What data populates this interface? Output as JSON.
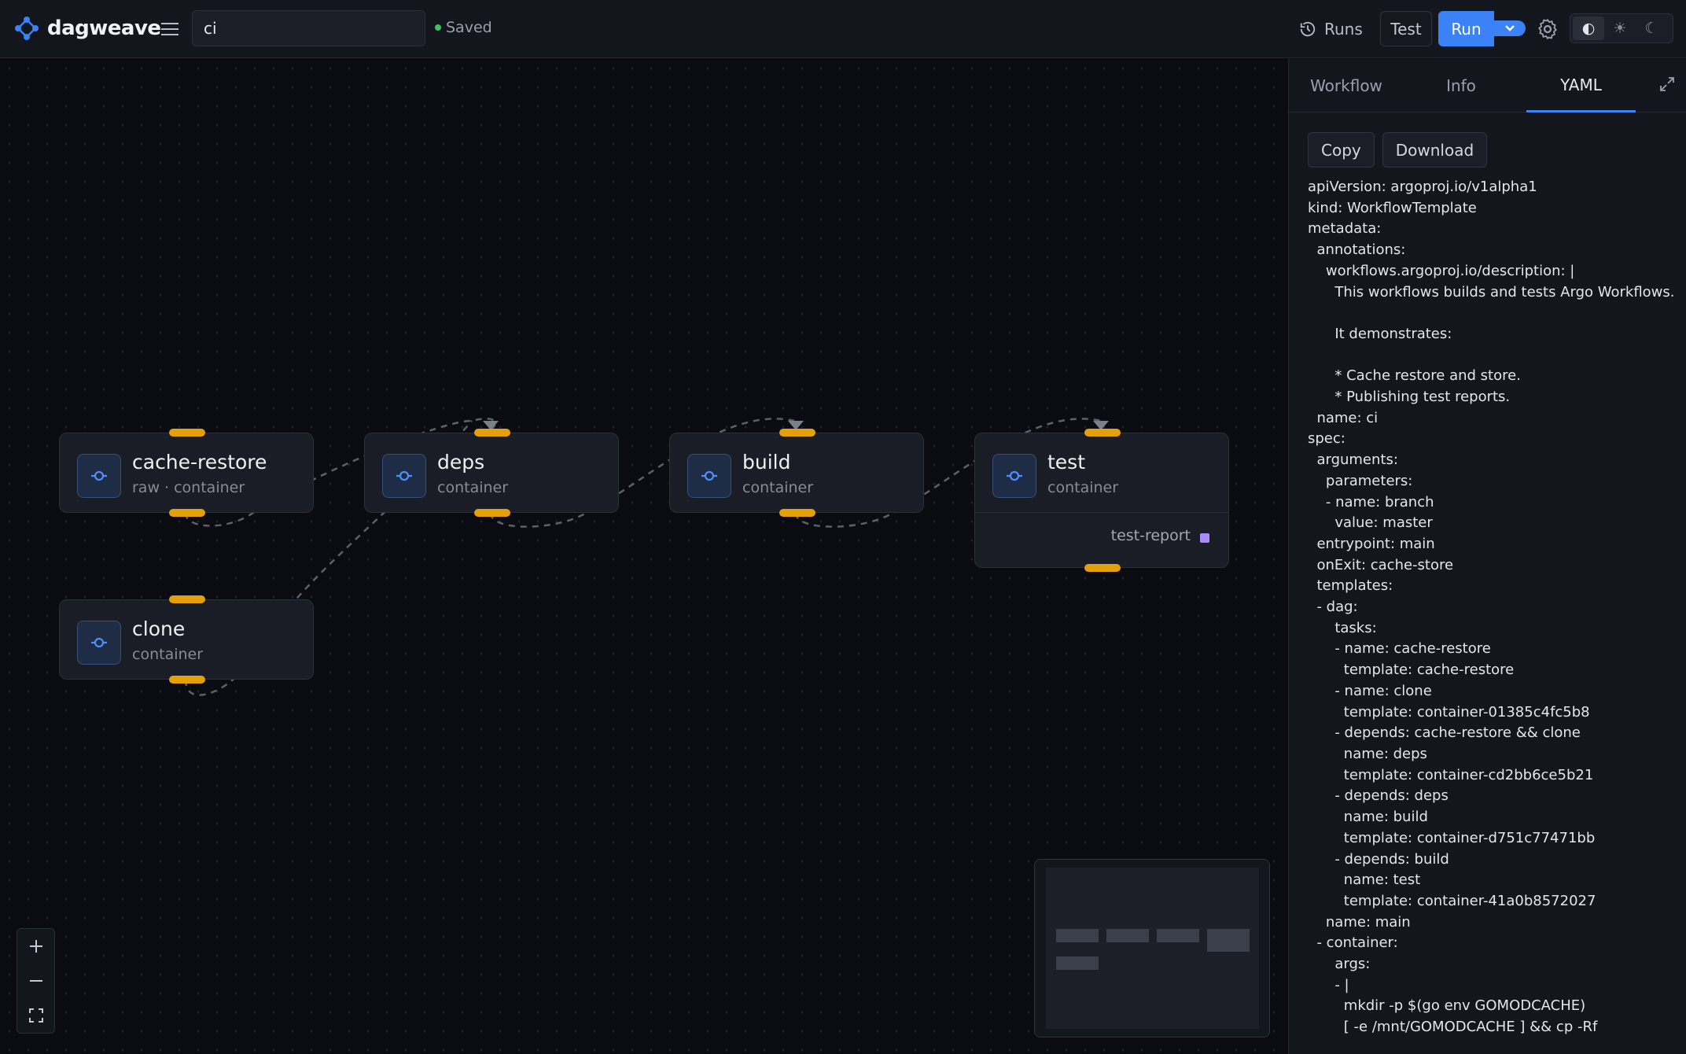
{
  "header": {
    "app_name": "dagweave",
    "workflow_name": "ci",
    "saved_label": "Saved",
    "runs_label": "Runs",
    "test_label": "Test",
    "run_label": "Run",
    "theme_auto": "◐",
    "theme_light": "☀",
    "theme_dark": "☾"
  },
  "nodes": {
    "cache_restore": {
      "title": "cache-restore",
      "subtitle": "raw · container"
    },
    "deps": {
      "title": "deps",
      "subtitle": "container"
    },
    "build": {
      "title": "build",
      "subtitle": "container"
    },
    "test": {
      "title": "test",
      "subtitle": "container",
      "output": "test-report"
    },
    "clone": {
      "title": "clone",
      "subtitle": "container"
    }
  },
  "panel": {
    "tabs": [
      "Workflow",
      "Info",
      "YAML"
    ],
    "active_tab": "YAML",
    "copy_label": "Copy",
    "download_label": "Download",
    "yaml": "apiVersion: argoproj.io/v1alpha1\nkind: WorkflowTemplate\nmetadata:\n  annotations:\n    workflows.argoproj.io/description: |\n      This workflows builds and tests Argo Workflows.\n\n      It demonstrates:\n\n      * Cache restore and store.\n      * Publishing test reports.\n  name: ci\nspec:\n  arguments:\n    parameters:\n    - name: branch\n      value: master\n  entrypoint: main\n  onExit: cache-store\n  templates:\n  - dag:\n      tasks:\n      - name: cache-restore\n        template: cache-restore\n      - name: clone\n        template: container-01385c4fc5b8\n      - depends: cache-restore && clone\n        name: deps\n        template: container-cd2bb6ce5b21\n      - depends: deps\n        name: build\n        template: container-d751c77471bb\n      - depends: build\n        name: test\n        template: container-41a0b8572027\n    name: main\n  - container:\n      args:\n      - |\n        mkdir -p $(go env GOMODCACHE)\n        [ -e /mnt/GOMODCACHE ] && cp -Rf"
  },
  "colors": {
    "accent": "#3b82f6",
    "handle": "#e3a008",
    "saved": "#3fbf5f",
    "artifact": "#a78bfa"
  },
  "icons": [
    "logo-icon",
    "menu-icon",
    "history-icon",
    "chevron-down-icon",
    "gear-icon",
    "expand-icon",
    "container-icon",
    "plus-icon",
    "minus-icon",
    "fit-view-icon"
  ]
}
